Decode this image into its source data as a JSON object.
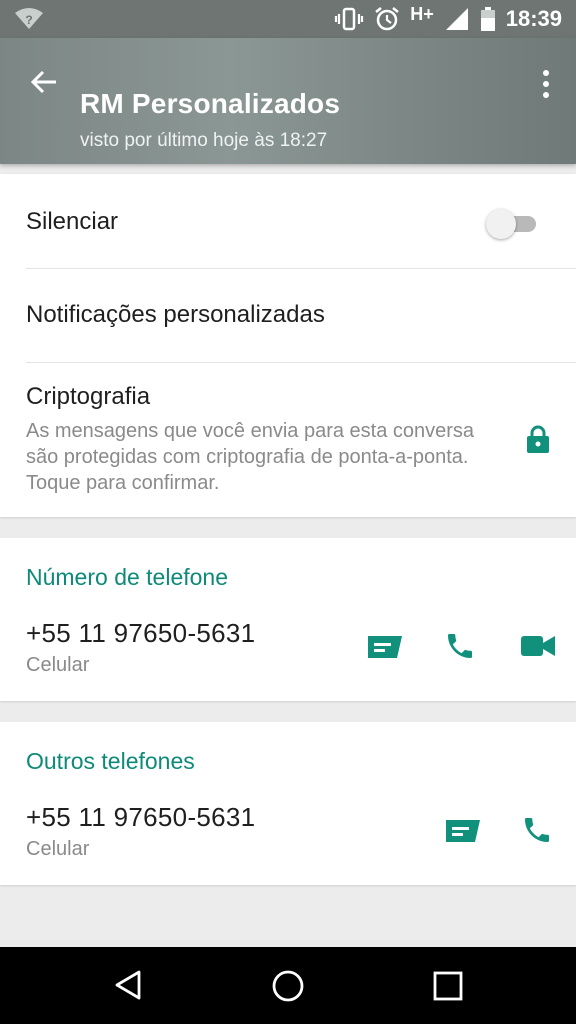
{
  "status_bar": {
    "time": "18:39",
    "network": "H+",
    "icons": [
      "wifi-unknown-icon",
      "vibrate-icon",
      "alarm-icon",
      "signal-icon",
      "battery-icon"
    ]
  },
  "header": {
    "title": "RM Personalizados",
    "subtitle": "visto por último hoje às 18:27"
  },
  "settings": {
    "mute_label": "Silenciar",
    "mute_enabled": false,
    "custom_notifications_label": "Notificações personalizadas",
    "encryption_label": "Criptografia",
    "encryption_description": "As mensagens que você envia para esta conversa são protegidas com criptografia de ponta-a-ponta. Toque para confirmar."
  },
  "phone_section": {
    "title": "Número de telefone",
    "number": "+55 11 97650-5631",
    "type": "Celular"
  },
  "other_phones_section": {
    "title": "Outros telefones",
    "number": "+55 11 97650-5631",
    "type": "Celular"
  },
  "colors": {
    "accent": "#0e8a78",
    "icon": "#11907c",
    "header": "#7f8a88"
  }
}
